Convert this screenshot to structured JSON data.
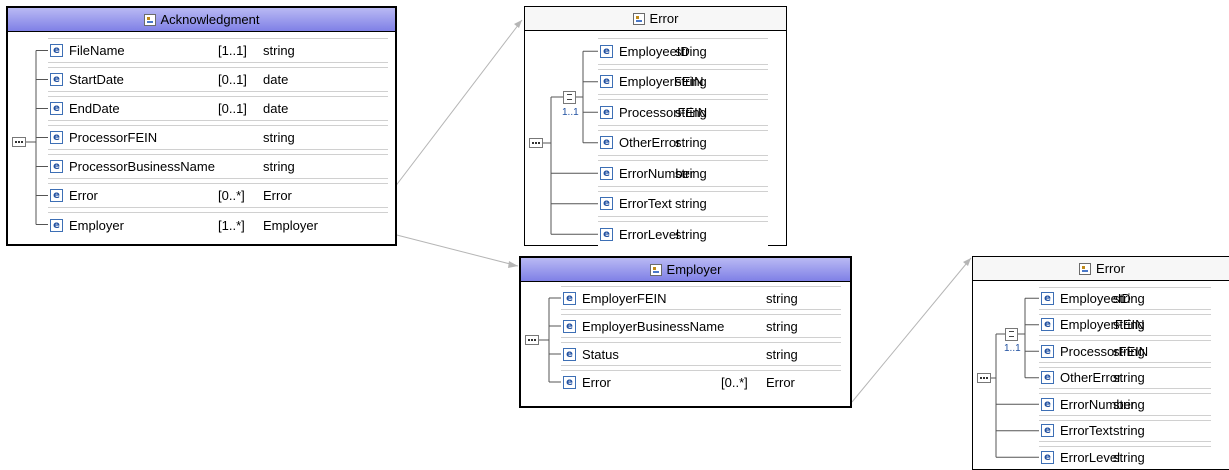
{
  "acknowledgment": {
    "title": "Acknowledgment",
    "rows": [
      {
        "name": "FileName",
        "card": "[1..1]",
        "type": "string"
      },
      {
        "name": "StartDate",
        "card": "[0..1]",
        "type": "date"
      },
      {
        "name": "EndDate",
        "card": "[0..1]",
        "type": "date"
      },
      {
        "name": "ProcessorFEIN",
        "card": "",
        "type": "string"
      },
      {
        "name": "ProcessorBusinessName",
        "card": "",
        "type": "string"
      },
      {
        "name": "Error",
        "card": "[0..*]",
        "type": "Error"
      },
      {
        "name": "Employer",
        "card": "[1..*]",
        "type": "Employer"
      }
    ]
  },
  "error_top": {
    "title": "Error",
    "choice_card": "1..1",
    "rows": [
      {
        "name": "EmployeeID",
        "type": "string"
      },
      {
        "name": "EmployerFEIN",
        "type": "string"
      },
      {
        "name": "ProcessorFEIN",
        "type": "string"
      },
      {
        "name": "OtherError",
        "type": "string"
      },
      {
        "name": "ErrorNumber",
        "type": "string"
      },
      {
        "name": "ErrorText",
        "type": "string"
      },
      {
        "name": "ErrorLevel",
        "type": "string"
      }
    ]
  },
  "employer": {
    "title": "Employer",
    "rows": [
      {
        "name": "EmployerFEIN",
        "card": "",
        "type": "string"
      },
      {
        "name": "EmployerBusinessName",
        "card": "",
        "type": "string"
      },
      {
        "name": "Status",
        "card": "",
        "type": "string"
      },
      {
        "name": "Error",
        "card": "[0..*]",
        "type": "Error"
      }
    ]
  },
  "error_bottom": {
    "title": "Error",
    "choice_card": "1..1",
    "rows": [
      {
        "name": "EmployeeID",
        "type": "string"
      },
      {
        "name": "EmployerFEIN",
        "type": "string"
      },
      {
        "name": "ProcessorFEIN",
        "type": "string"
      },
      {
        "name": "OtherError",
        "type": "string"
      },
      {
        "name": "ErrorNumber",
        "type": "string"
      },
      {
        "name": "ErrorText",
        "type": "string"
      },
      {
        "name": "ErrorLevel",
        "type": "string"
      }
    ]
  },
  "icons": {
    "element_glyph": "e",
    "element_icon": "element-icon",
    "type_icon": "complex-type-icon"
  },
  "colors": {
    "selected_header": "#7f80e6",
    "plain_header": "#f7f7f7",
    "icon_blue": "#1f4fa0",
    "connector": "#b5b5b5"
  }
}
